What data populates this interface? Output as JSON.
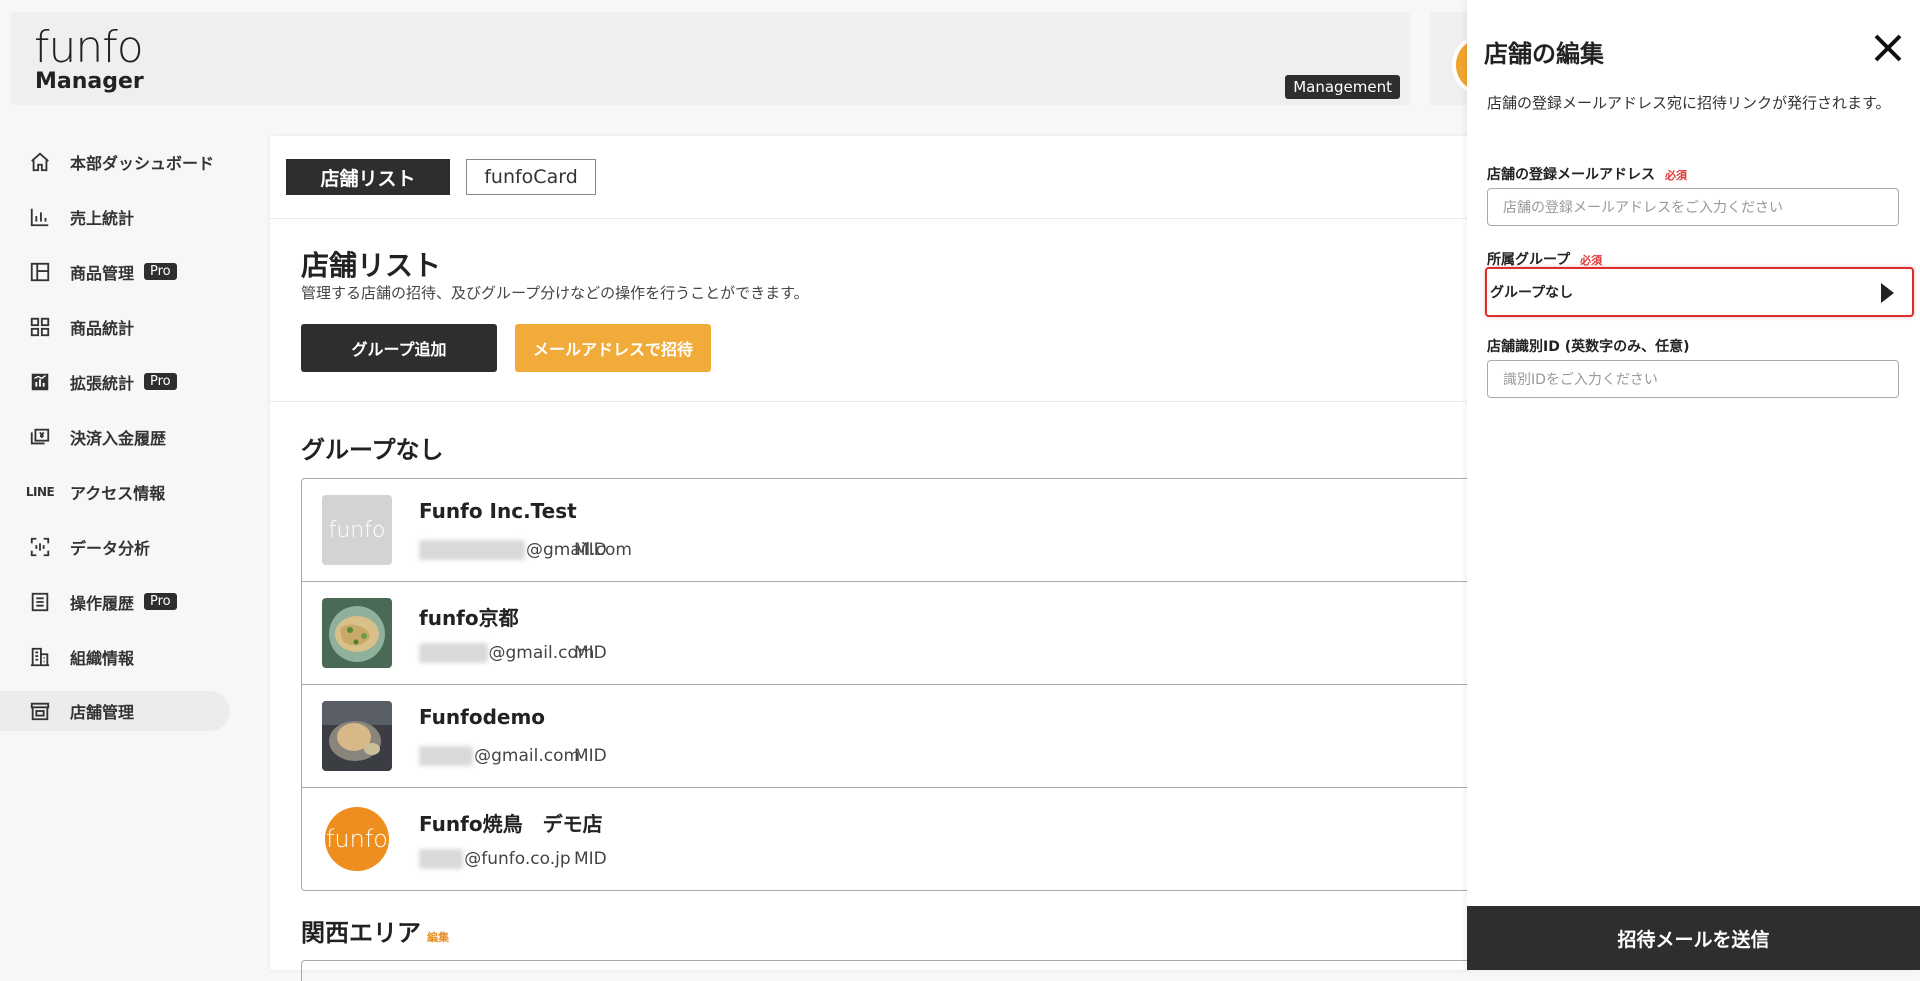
{
  "header": {
    "logo_main": "funfo",
    "logo_sub": "Manager",
    "badge": "Management"
  },
  "sidebar": {
    "items": [
      {
        "label": "本部ダッシュボード",
        "icon": "home-icon",
        "pro": false
      },
      {
        "label": "売上統計",
        "icon": "bar-chart-icon",
        "pro": false
      },
      {
        "label": "商品管理",
        "icon": "layout-icon",
        "pro": true
      },
      {
        "label": "商品統計",
        "icon": "grid-icon",
        "pro": false
      },
      {
        "label": "拡張統計",
        "icon": "chart-box-icon",
        "pro": true
      },
      {
        "label": "決済入金履歴",
        "icon": "payment-icon",
        "pro": false
      },
      {
        "label": "アクセス情報",
        "icon": "line-icon",
        "icon_text": "LINE",
        "pro": false
      },
      {
        "label": "データ分析",
        "icon": "scan-icon",
        "pro": false
      },
      {
        "label": "操作履歴",
        "icon": "list-icon",
        "pro": true
      },
      {
        "label": "組織情報",
        "icon": "building-icon",
        "pro": false
      },
      {
        "label": "店舗管理",
        "icon": "store-icon",
        "pro": false,
        "active": true
      }
    ],
    "pro_label": "Pro"
  },
  "main": {
    "tabs": [
      {
        "label": "店舗リスト",
        "active": true
      },
      {
        "label": "funfoCard",
        "active": false
      }
    ],
    "title": "店舗リスト",
    "description": "管理する店舗の招待、及びグループ分けなどの操作を行うことができます。",
    "add_group_button": "グループ追加",
    "invite_button": "メールアドレスで招待",
    "group_none_title": "グループなし",
    "stores": [
      {
        "name": "Funfo Inc.Test",
        "email_blur": "gamerclubjp",
        "email_domain": "@gmail.com",
        "mid": "MID",
        "thumb": "grey",
        "thumb_text": "funfo"
      },
      {
        "name": "funfo京都",
        "email_blur": "akurujni",
        "email_domain": "@gmail.com",
        "mid": "MID",
        "thumb": "pasta"
      },
      {
        "name": "Funfodemo",
        "email_blur": "leruno",
        "email_domain": "@gmail.com",
        "mid": "MID",
        "thumb": "dish"
      },
      {
        "name": "Funfo焼鳥　デモ店",
        "email_blur": "asaki",
        "email_domain": "@funfo.co.jp",
        "mid": "MID",
        "thumb": "orange",
        "thumb_text": "funfo"
      }
    ],
    "group2_title": "関西エリア",
    "group2_edit": "編集"
  },
  "drawer": {
    "title": "店舗の編集",
    "description": "店舗の登録メールアドレス宛に招待リンクが発行されます。",
    "email_label": "店舗の登録メールアドレス",
    "required": "必須",
    "email_placeholder": "店舗の登録メールアドレスをご入力ください",
    "group_label": "所属グループ",
    "group_value": "グループなし",
    "id_label": "店舗識別ID (英数字のみ、任意)",
    "id_placeholder": "識別IDをご入力ください",
    "submit": "招待メールを送信"
  },
  "colors": {
    "dark": "#2e2e2e",
    "orange": "#f0ab3a",
    "required_red": "#e03b3b",
    "highlight_red": "#d9302f"
  }
}
